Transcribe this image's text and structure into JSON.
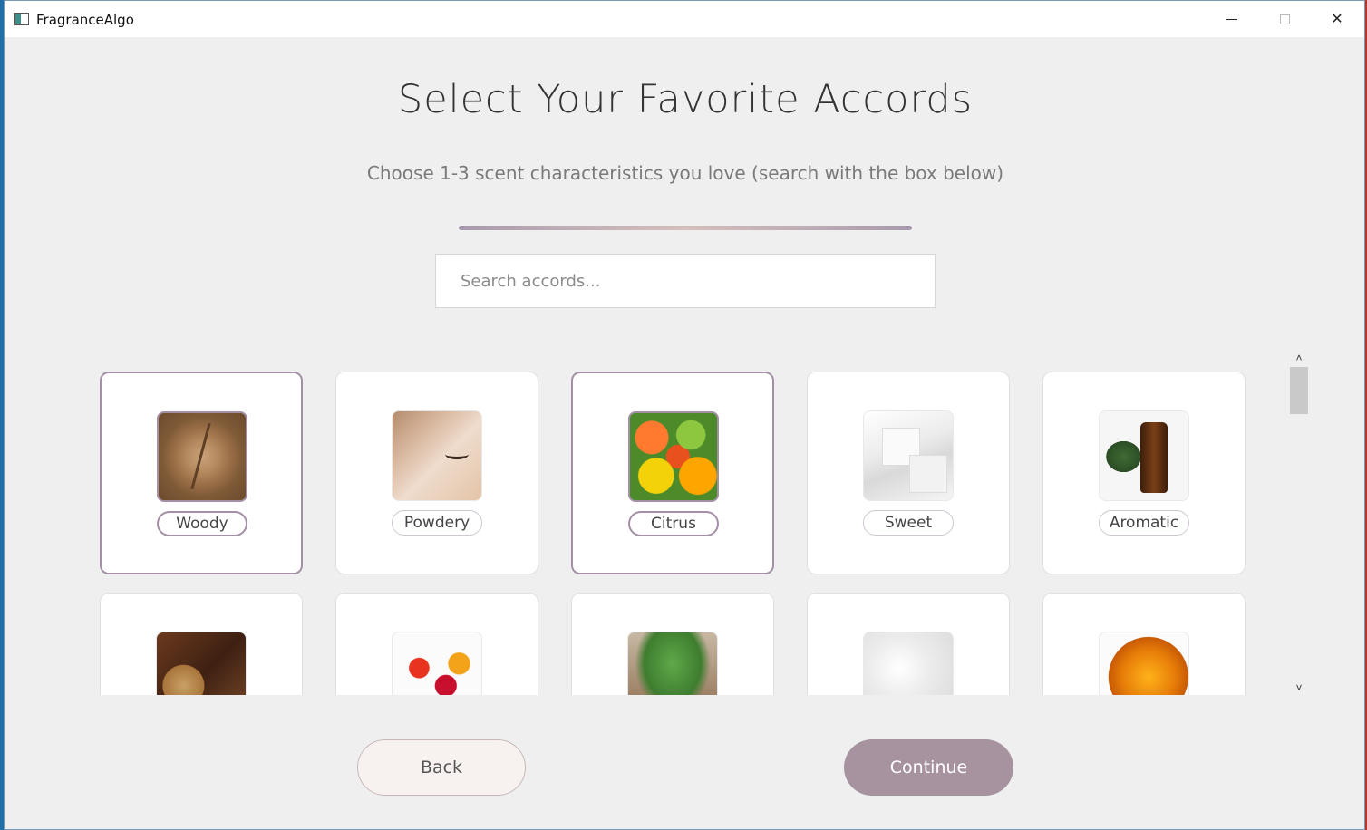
{
  "window": {
    "title": "FragranceAlgo",
    "close_glyph": "✕"
  },
  "header": {
    "title": "Select Your Favorite Accords",
    "subtitle": "Choose 1-3 scent characteristics you love (search with the box below)"
  },
  "search": {
    "placeholder": "Search accords...",
    "value": ""
  },
  "accords": [
    {
      "label": "Woody",
      "selected": true,
      "image": "woody"
    },
    {
      "label": "Powdery",
      "selected": false,
      "image": "powdery"
    },
    {
      "label": "Citrus",
      "selected": true,
      "image": "citrus"
    },
    {
      "label": "Sweet",
      "selected": false,
      "image": "sweet"
    },
    {
      "label": "Aromatic",
      "selected": false,
      "image": "aromatic"
    },
    {
      "label": "",
      "selected": false,
      "image": "spicy"
    },
    {
      "label": "",
      "selected": false,
      "image": "floral"
    },
    {
      "label": "",
      "selected": false,
      "image": "fresh"
    },
    {
      "label": "",
      "selected": false,
      "image": "white-floral"
    },
    {
      "label": "",
      "selected": false,
      "image": "amber"
    }
  ],
  "scrollbar": {
    "up_glyph": "˄",
    "down_glyph": "˅"
  },
  "footer": {
    "back_label": "Back",
    "continue_label": "Continue"
  },
  "colors": {
    "accent": "#a48fa7",
    "continue_bg": "#a6939f",
    "back_bg": "#f7f2ef",
    "page_bg": "#efefef"
  }
}
